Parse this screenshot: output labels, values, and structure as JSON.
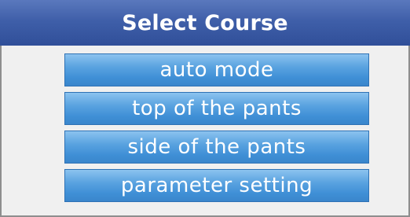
{
  "dialog": {
    "title": "Select Course"
  },
  "menu": {
    "items": [
      {
        "label": "auto mode"
      },
      {
        "label": "top of the pants"
      },
      {
        "label": "side of the pants"
      },
      {
        "label": "parameter setting"
      }
    ]
  },
  "colors": {
    "title_bar": "#3f5fa9",
    "button": "#4a97db",
    "panel_background": "#f0f0f0"
  }
}
